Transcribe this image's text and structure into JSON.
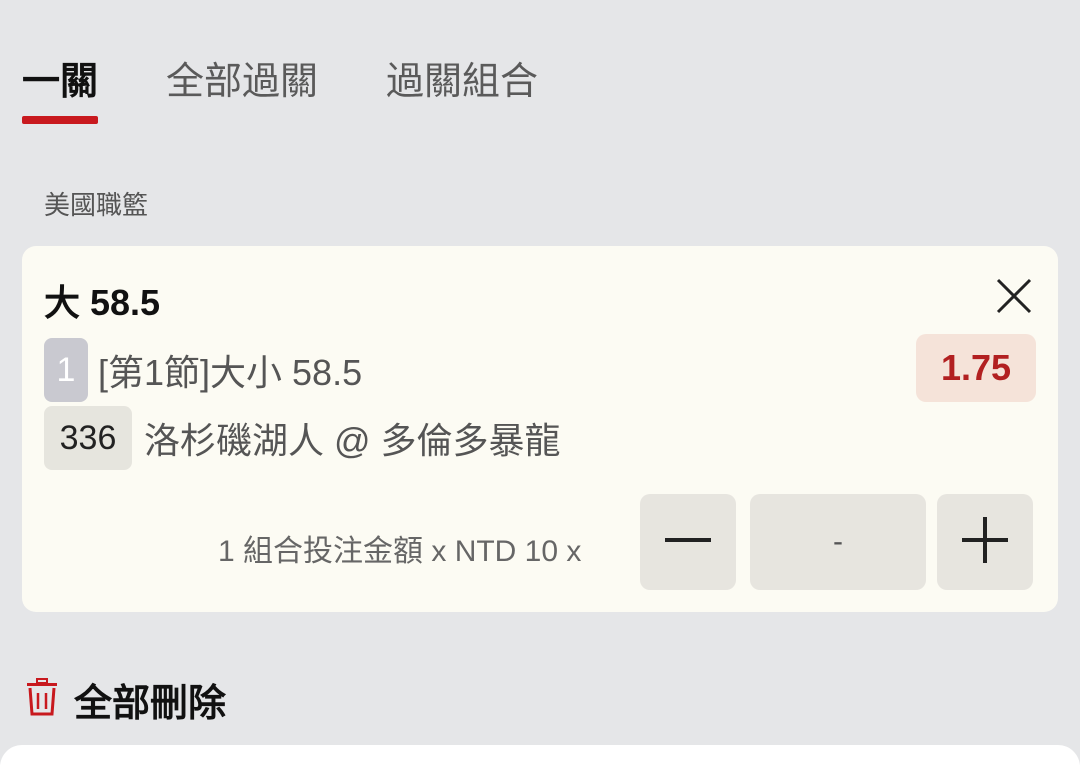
{
  "tabs": [
    {
      "label": "一關",
      "active": true
    },
    {
      "label": "全部過關",
      "active": false
    },
    {
      "label": "過關組合",
      "active": false
    }
  ],
  "league": "美國職籃",
  "bet": {
    "selection": "大 58.5",
    "leg_index": "1",
    "market": "[第1節]大小 58.5",
    "odds": "1.75",
    "match_code": "336",
    "match": "洛杉磯湖人 @ 多倫多暴龍",
    "stake_label": "1 組合投注金額 x NTD 10 x",
    "amount": "-"
  },
  "delete_all_label": "全部刪除",
  "colors": {
    "accent": "#c8191e",
    "odds_text": "#b22021",
    "odds_bg": "#f5e3d9"
  },
  "icons": [
    "close-icon",
    "minus-icon",
    "plus-icon",
    "trash-icon"
  ]
}
